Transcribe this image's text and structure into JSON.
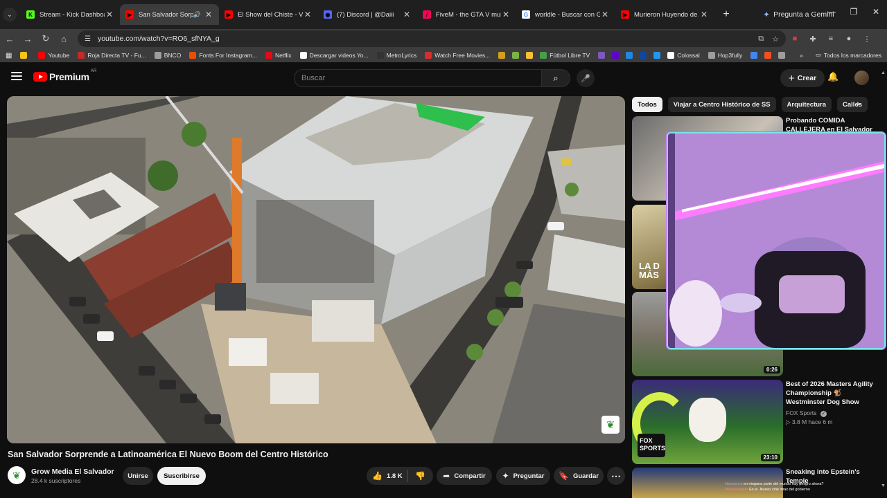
{
  "browser": {
    "tabs": [
      {
        "title": "Stream - Kick Dashboard",
        "favicon": "kick-icon",
        "color": "#53fc18",
        "glyph": "K"
      },
      {
        "title": "San Salvador Sorprende",
        "favicon": "youtube-icon",
        "color": "#ff0000",
        "glyph": "▶",
        "active": true,
        "audio": true
      },
      {
        "title": "El Show del Chiste - VIDEO",
        "favicon": "youtube-icon",
        "color": "#ff0000",
        "glyph": "▶"
      },
      {
        "title": "(7) Discord | @Daiii",
        "favicon": "discord-icon",
        "color": "#5865f2",
        "glyph": "◉"
      },
      {
        "title": "FiveM - the GTA V multipl",
        "favicon": "fivem-icon",
        "color": "#f40552",
        "glyph": "/"
      },
      {
        "title": "worldle - Buscar con Goog",
        "favicon": "google-icon",
        "color": "#ffffff",
        "glyph": "G"
      },
      {
        "title": "Murieron Huyendo de Alg",
        "favicon": "youtube-icon",
        "color": "#ff0000",
        "glyph": "▶"
      }
    ],
    "gemini_label": "Pregunta a Gemini",
    "url": "youtube.com/watch?v=RO6_sfNYA_g",
    "bookmarks": [
      {
        "label": "",
        "color": "#f5c518"
      },
      {
        "label": "Youtube",
        "color": "#ff0000"
      },
      {
        "label": "Roja Directa TV - Fu...",
        "color": "#c62828"
      },
      {
        "label": "BNCO",
        "color": "#9e9e9e"
      },
      {
        "label": "Fonts For Instagram...",
        "color": "#e65100"
      },
      {
        "label": "Netflix",
        "color": "#e50914"
      },
      {
        "label": "Descargar videos Yo...",
        "color": "#ffffff"
      },
      {
        "label": "MetroLyrics",
        "color": "#333333"
      },
      {
        "label": "Watch Free Movies...",
        "color": "#d32f2f"
      }
    ],
    "bookmarks_icons_only": [
      "#d4a017",
      "#7cb342",
      "#fbc02d"
    ],
    "bookmarks_after": [
      {
        "label": "Fútbol Libre TV",
        "color": "#43a047"
      }
    ],
    "bookmarks_icons_only_2": [
      "#7e57c2",
      "#6001d2",
      "#1e88e5",
      "#0d47a1",
      "#2196f3"
    ],
    "bookmarks_after_2": [
      {
        "label": "Colossal",
        "color": "#ffffff"
      },
      {
        "label": "Hop3fully",
        "color": "#9e9e9e"
      }
    ],
    "bookmarks_icons_only_3": [
      "#4285f4",
      "#f25022",
      "#9e9e9e"
    ],
    "all_bookmarks_label": "Todos los marcadores"
  },
  "youtube": {
    "brand": "Premium",
    "region": "AR",
    "search_placeholder": "Buscar",
    "create_label": "Crear",
    "video": {
      "title": "San Salvador Sorprende a Latinoamérica El Nuevo Boom del Centro Histórico",
      "channel": "Grow Media El Salvador",
      "subscribers": "28.4 k suscriptores",
      "join_label": "Unirse",
      "subscribe_label": "Suscribirse",
      "likes": "1.8 K",
      "share_label": "Compartir",
      "ask_label": "Preguntar",
      "save_label": "Guardar"
    },
    "chips": [
      "Todos",
      "Viajar a Centro Histórico de SS",
      "Arquitectura",
      "Calles"
    ],
    "related": [
      {
        "title": "Probando COMIDA CALLEJERA en El Salvador",
        "channel": "",
        "meta": "",
        "duration": ""
      },
      {
        "title": "",
        "channel": "",
        "meta": "",
        "duration": "",
        "thumb_text": "LA D MÁS"
      },
      {
        "title": "",
        "channel": "",
        "meta": "",
        "duration": "0:26"
      },
      {
        "title": "Best of 2026 Masters Agility Championship 🐒 Westminster Dog Show",
        "channel": "FOX Sports",
        "meta": "3.8 M  hace 6 m",
        "duration": "23:10",
        "thumb_text": "FOX SPORTS"
      },
      {
        "title": "Sneaking into Epstein's Temple",
        "channel": "",
        "meta": "",
        "duration": ""
      }
    ],
    "chat_overlay": [
      {
        "user": "Nakamura",
        "text": "en ninguna parte del mundo hay peligro ahora?"
      },
      {
        "user": "Maumediapro",
        "text": "Es el. Nuevo cine imax del gobierno"
      }
    ]
  }
}
